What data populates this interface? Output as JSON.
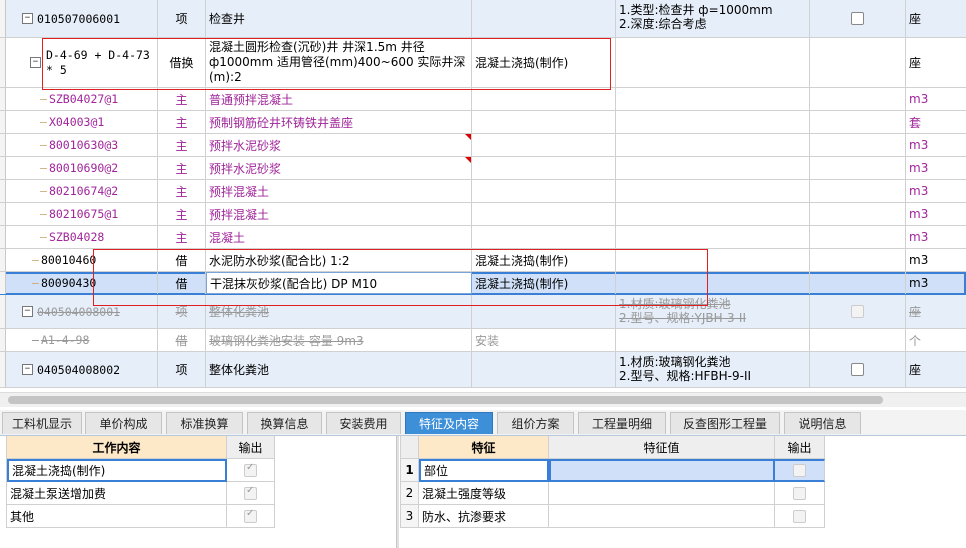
{
  "grid": {
    "rows": [
      {
        "code": "010507006001",
        "type": "项",
        "name": "检查井",
        "work": "",
        "features": "1.类型:检查井 ф=1000mm\n2.深度:综合考虑",
        "checked": false,
        "unit": "座"
      },
      {
        "code": "D-4-69 + D-4-73 * 5",
        "type": "借换",
        "name": "混凝土圆形检查(沉砂)井 井深1.5m 井径ф1000mm 适用管径(mm)400~600  实际井深(m):2",
        "work": "混凝土浇捣(制作)",
        "features": "",
        "unit": "座"
      },
      {
        "code": "SZB04027@1",
        "type": "主",
        "name": "普通预拌混凝土",
        "work": "",
        "features": "",
        "unit": "m3"
      },
      {
        "code": "X04003@1",
        "type": "主",
        "name": "预制钢筋砼井环铸铁井盖座",
        "work": "",
        "features": "",
        "unit": "套"
      },
      {
        "code": "80010630@3",
        "type": "主",
        "name": "预拌水泥砂浆",
        "work": "",
        "features": "",
        "unit": "m3"
      },
      {
        "code": "80010690@2",
        "type": "主",
        "name": "预拌水泥砂浆",
        "work": "",
        "features": "",
        "unit": "m3"
      },
      {
        "code": "80210674@2",
        "type": "主",
        "name": "预拌混凝土",
        "work": "",
        "features": "",
        "unit": "m3"
      },
      {
        "code": "80210675@1",
        "type": "主",
        "name": "预拌混凝土",
        "work": "",
        "features": "",
        "unit": "m3"
      },
      {
        "code": "SZB04028",
        "type": "主",
        "name": "混凝土",
        "work": "",
        "features": "",
        "unit": "m3"
      },
      {
        "code": "80010460",
        "type": "借",
        "name": "水泥防水砂浆(配合比) 1:2",
        "work": "混凝土浇捣(制作)",
        "features": "",
        "unit": "m3"
      },
      {
        "code": "80090430",
        "type": "借",
        "name": "干混抹灰砂浆(配合比) DP M10",
        "work": "混凝土浇捣(制作)",
        "features": "",
        "unit": "m3"
      },
      {
        "code": "040504008001",
        "type": "项",
        "name": "整体化粪池",
        "work": "",
        "features": "1.材质:玻璃钢化粪池\n2.型号、规格:YJBH-3-II",
        "checked": false,
        "unit": "座"
      },
      {
        "code": "A1-4-98",
        "type": "借",
        "name": "玻璃钢化粪池安装 容量 9m3",
        "work": "安装",
        "features": "",
        "unit": "个"
      },
      {
        "code": "040504008002",
        "type": "项",
        "name": "整体化粪池",
        "work": "",
        "features": "1.材质:玻璃钢化粪池\n2.型号、规格:HFBH-9-II",
        "checked": false,
        "unit": "座"
      }
    ]
  },
  "tabs": [
    "工料机显示",
    "单价构成",
    "标准换算",
    "换算信息",
    "安装费用",
    "特征及内容",
    "组价方案",
    "工程量明细",
    "反查图形工程量",
    "说明信息"
  ],
  "tree_glyph": "—",
  "expander": {
    "collapsed": "+",
    "expanded": "−"
  },
  "work_table": {
    "header_content": "工作内容",
    "header_output": "输出",
    "rows": [
      {
        "label": "混凝土浇捣(制作)",
        "checked": true
      },
      {
        "label": "混凝土泵送增加费",
        "checked": true
      },
      {
        "label": "其他",
        "checked": true
      }
    ]
  },
  "feature_table": {
    "header_feature": "特征",
    "header_value": "特征值",
    "header_output": "输出",
    "rows": [
      {
        "no": "1",
        "feature": "部位",
        "value": "",
        "checked": false
      },
      {
        "no": "2",
        "feature": "混凝土强度等级",
        "value": "",
        "checked": false
      },
      {
        "no": "3",
        "feature": "防水、抗渗要求",
        "value": "",
        "checked": false
      }
    ]
  },
  "colors": {
    "accent": "#3d8fd8",
    "selection": "#cfe0f8",
    "qing": "#e6eef9",
    "purple": "#a0249a",
    "highlight_box": "#e02020"
  }
}
